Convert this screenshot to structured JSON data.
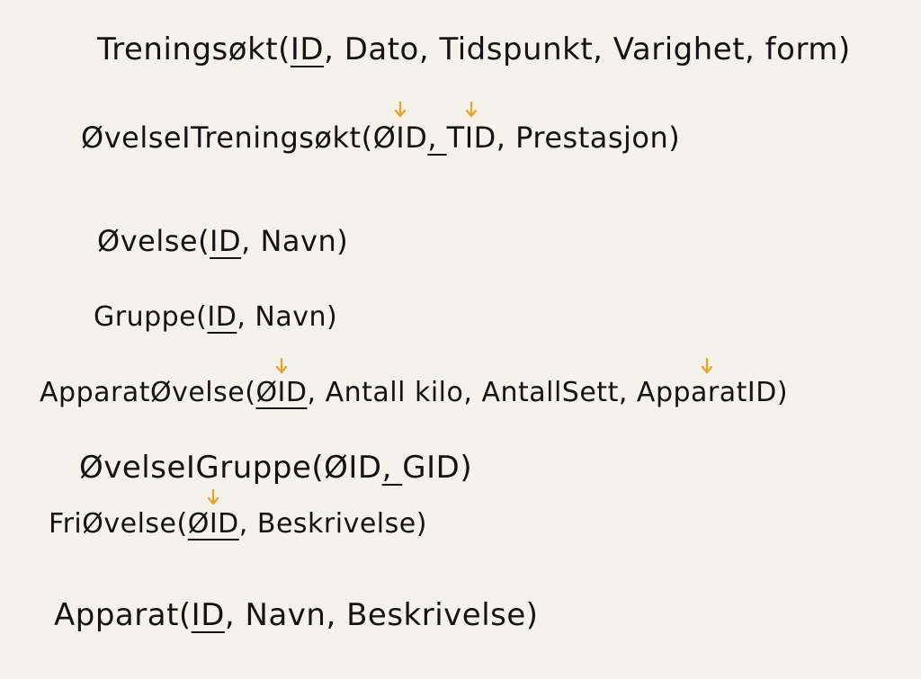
{
  "relations": [
    {
      "name": "Treningsøkt",
      "attrs": [
        {
          "text": "ID",
          "pk": true,
          "fk": false
        },
        {
          "text": "Dato",
          "pk": false,
          "fk": false
        },
        {
          "text": "Tidspunkt",
          "pk": false,
          "fk": false
        },
        {
          "text": "Varighet",
          "pk": false,
          "fk": false
        },
        {
          "text": "form",
          "pk": false,
          "fk": false
        }
      ]
    },
    {
      "name": "ØvelseITreningsøkt",
      "attrs": [
        {
          "text": "ØID",
          "pk": true,
          "fk": true
        },
        {
          "text": "TID",
          "pk": true,
          "fk": true
        },
        {
          "text": "Prestasjon",
          "pk": false,
          "fk": false
        }
      ]
    },
    {
      "name": "Øvelse",
      "attrs": [
        {
          "text": "ID",
          "pk": true,
          "fk": false
        },
        {
          "text": "Navn",
          "pk": false,
          "fk": false
        }
      ]
    },
    {
      "name": "Gruppe",
      "attrs": [
        {
          "text": "ID",
          "pk": true,
          "fk": false
        },
        {
          "text": "Navn",
          "pk": false,
          "fk": false
        }
      ]
    },
    {
      "name": "ApparatØvelse",
      "attrs": [
        {
          "text": "ØID",
          "pk": true,
          "fk": true
        },
        {
          "text": "Antall kilo",
          "pk": false,
          "fk": false
        },
        {
          "text": "AntallSett",
          "pk": false,
          "fk": false
        },
        {
          "text": "ApparatID",
          "pk": false,
          "fk": true
        }
      ]
    },
    {
      "name": "ØvelseIGruppe",
      "attrs": [
        {
          "text": "ØID",
          "pk": true,
          "fk": false
        },
        {
          "text": "GID",
          "pk": true,
          "fk": false
        }
      ]
    },
    {
      "name": "FriØvelse",
      "attrs": [
        {
          "text": "ØID",
          "pk": true,
          "fk": true
        },
        {
          "text": "Beskrivelse",
          "pk": false,
          "fk": false
        }
      ]
    },
    {
      "name": "Apparat",
      "attrs": [
        {
          "text": "ID",
          "pk": true,
          "fk": false
        },
        {
          "text": "Navn",
          "pk": false,
          "fk": false
        },
        {
          "text": "Beskrivelse",
          "pk": false,
          "fk": false
        }
      ]
    }
  ],
  "colors": {
    "ink": "#141414",
    "fk_arrow": "#f0a020",
    "paper": "#f5f2ec"
  },
  "icons": {
    "foreign_key_marker": "down-arrow-icon"
  }
}
